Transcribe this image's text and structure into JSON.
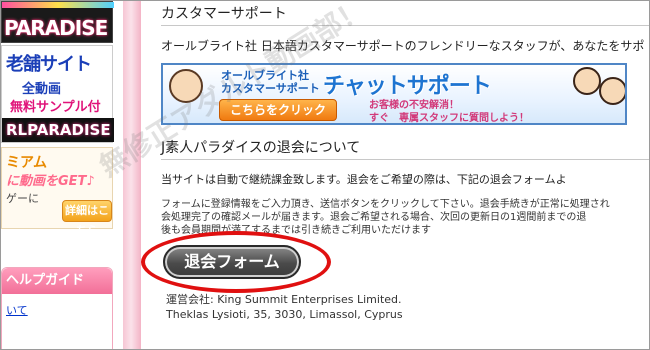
{
  "sidebar": {
    "banner_paradise": "PARADISE",
    "banner_shinise": {
      "title": "老舗サイト",
      "line2": "全動画",
      "line3": "無料サンプル付",
      "footer": "RLPARADISE"
    },
    "banner_premium": {
      "title": "ミアム",
      "tagline": "に動画をGET♪",
      "note": "ゲーに",
      "details_button": "詳細はこちら"
    },
    "help_guide": {
      "header": "ヘルプガイド",
      "item": "いて"
    }
  },
  "main": {
    "customer_support_heading": "カスタマーサポート",
    "customer_support_desc": "オールブライト社 日本語カスタマーサポートのフレンドリーなスタッフが、あなたをサポ",
    "chat_banner": {
      "company_line1": "オールブライト社",
      "company_line2": "カスタマーサポート",
      "title": "チャットサポート",
      "click_button": "こちらをクリック",
      "message_line1": "お客様の不安解消！",
      "message_line2": "すぐ　専属スタッフに質問しよう！"
    },
    "cancel_heading": "J素人パラダイスの退会について",
    "cancel_desc": "当サイトは自動で継続課金致します。退会をご希望の際は、下記の退会フォームよ",
    "form_instructions": {
      "line1": "フォームに登録情報をご入力頂き、送信ボタンをクリックして下さい。退会手続きが正常に処理され",
      "line2": "会処理完了の確認メールが届きます。退会ご希望される場合、次回の更新日の1週間前までの退",
      "line3": "後も会員期間が満了するまでは引き続きご利用いただけます"
    },
    "cancel_form_button": "退会フォーム",
    "company_info": {
      "line1": "運営会社: King Summit Enterprises Limited.",
      "line2": "Theklas Lysioti, 35, 3030, Limassol, Cyprus"
    }
  },
  "watermark": "無修正アダルト動画部！",
  "colors": {
    "highlight_ring": "#e01010",
    "pink_stripe": "#f6c6d4",
    "button_dark": "#4a4a4a"
  }
}
